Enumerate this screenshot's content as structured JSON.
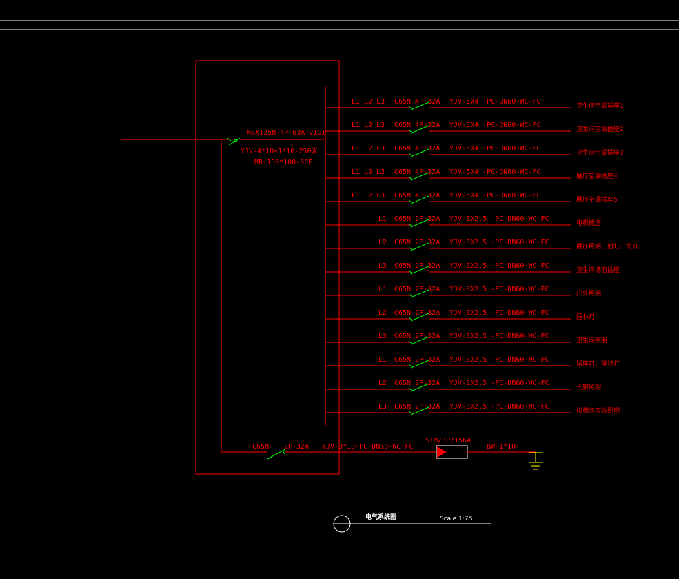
{
  "colors": {
    "background": "#000000",
    "frame": "#ffffff",
    "wire": "#ff0000",
    "switch": "#00ff00",
    "text": "#ff0000",
    "ground": "#ffff00",
    "spd_fill": "#ff0000",
    "title_text": "#ffffff"
  },
  "incoming": {
    "breaker": "NSX125N-4P-63A-VIGI",
    "cable": "YJV-4*10+1*10-250米",
    "tray": "MR-150*100-SCE"
  },
  "circuits": [
    {
      "phase": "L1 L2 L3",
      "breaker": "C65N 4P-32A",
      "cable": "YJV-5X4  -PC-DN60-WC-FC",
      "load": "卫生间空调插座1"
    },
    {
      "phase": "L1 L2 L3",
      "breaker": "C65N 4P-32A",
      "cable": "YJV-5X4  -PC-DN60-WC-FC",
      "load": "卫生间空调插座2"
    },
    {
      "phase": "L1 L2 L3",
      "breaker": "C65N 4P-32A",
      "cable": "YJV-5X4  -PC-DN60-WC-FC",
      "load": "卫生间空调插座3"
    },
    {
      "phase": "L1 L2 L3",
      "breaker": "C65N 4P-32A",
      "cable": "YJV-5X4  -PC-DN60-WC-FC",
      "load": "展厅空调插座4"
    },
    {
      "phase": "L1 L2 L3",
      "breaker": "C65N 4P-32A",
      "cable": "YJV-5X4  -PC-DN60-WC-FC",
      "load": "展厅空调插座5"
    },
    {
      "phase": "L1",
      "breaker": "C65N 2P-32A",
      "cable": "YJV-3X2.5  -PC-DN60-WC-FC",
      "load": "电视插座"
    },
    {
      "phase": "L2",
      "breaker": "C65N 2P-32A",
      "cable": "YJV-3X2.5  -PC-DN60-WC-FC",
      "load": "展厅照明、射灯、筒灯"
    },
    {
      "phase": "L3",
      "breaker": "C65N 2P-32A",
      "cable": "YJV-3X2.5  -PC-DN60-WC-FC",
      "load": "卫生间墙面插座"
    },
    {
      "phase": "L1",
      "breaker": "C65N 2P-32A",
      "cable": "YJV-3X2.5  -PC-DN60-WC-FC",
      "load": "户外照明"
    },
    {
      "phase": "L2",
      "breaker": "C65N 2P-32A",
      "cable": "YJV-3X2.5  -PC-DN60-WC-FC",
      "load": "园林灯"
    },
    {
      "phase": "L3",
      "breaker": "C65N 2P-32A",
      "cable": "YJV-3X2.5  -PC-DN60-WC-FC",
      "load": "卫生间照明"
    },
    {
      "phase": "L1",
      "breaker": "C65N 2P-32A",
      "cable": "YJV-3X2.5  -PC-DN60-WC-FC",
      "load": "插座灯、壁挂灯"
    },
    {
      "phase": "L2",
      "breaker": "C65N 2P-32A",
      "cable": "YJV-3X2.5  -PC-DN60-WC-FC",
      "load": "长廊照明"
    },
    {
      "phase": "L3",
      "breaker": "C65N 2P-32A",
      "cable": "YJV-3X2.5  -PC-DN60-WC-FC",
      "load": "楼梯间应急照明"
    }
  ],
  "spd_branch": {
    "breaker_model": "C65N",
    "breaker_rating": "2P-32A",
    "cable": "YJV-3*10-PC-DN60-WC-FC",
    "spd": "STM/3P/15KA",
    "ground_wire": "BW-1*10"
  },
  "title_block": {
    "title": "电气系统图",
    "scale": "Scale 1:75"
  }
}
